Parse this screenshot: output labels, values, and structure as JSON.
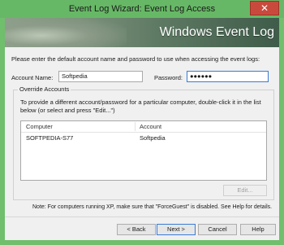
{
  "window": {
    "title": "Event Log Wizard: Event Log Access",
    "close_glyph": "✕"
  },
  "banner": {
    "title": "Windows Event Log"
  },
  "intro_text": "Please enter the default account name and password to use when accessing the event logs:",
  "account": {
    "label": "Account Name:",
    "value": "Softpedia"
  },
  "password": {
    "label": "Password:",
    "value": "●●●●●●"
  },
  "override": {
    "title": "Override Accounts",
    "description": "To provide a different account/password for a particular computer, double-click it in the list below (or select and press \"Edit...\")",
    "columns": [
      "Computer",
      "Account"
    ],
    "rows": [
      {
        "computer": "SOFTPEDIA-S77",
        "account": "Softpedia"
      }
    ],
    "edit_label": "Edit..."
  },
  "note": "Note: For computers running XP, make sure that \"ForceGuest\" is disabled. See Help for details.",
  "buttons": {
    "back": "< Back",
    "next": "Next >",
    "cancel": "Cancel",
    "help": "Help"
  }
}
